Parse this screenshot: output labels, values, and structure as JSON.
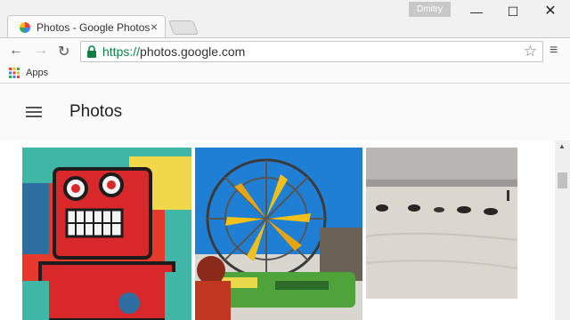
{
  "browser": {
    "tab_title": "Photos - Google Photos",
    "tab_close": "×",
    "profile_name": "Dmitry",
    "window_controls": {
      "minimize": "—",
      "maximize": "☐",
      "close": "✕"
    },
    "url_scheme": "https://",
    "url_rest": "photos.google.com",
    "nav": {
      "back": "←",
      "forward": "→",
      "reload": "↻"
    },
    "star": "☆",
    "menu": "≡",
    "bookmarks": {
      "apps_label": "Apps"
    }
  },
  "page": {
    "title": "Photos"
  },
  "photos": [
    {
      "name": "robot-poster-photo",
      "icon": "robot-illustration"
    },
    {
      "name": "ferris-wheel-art-car-photo",
      "icon": "art-car-windmill"
    },
    {
      "name": "dog-sled-snow-photo",
      "icon": "dogs-on-snow"
    }
  ],
  "scrollbar": {
    "up_arrow": "▲"
  },
  "colors": {
    "accent_green": "#0b8043",
    "header_bg": "#fafafa"
  }
}
